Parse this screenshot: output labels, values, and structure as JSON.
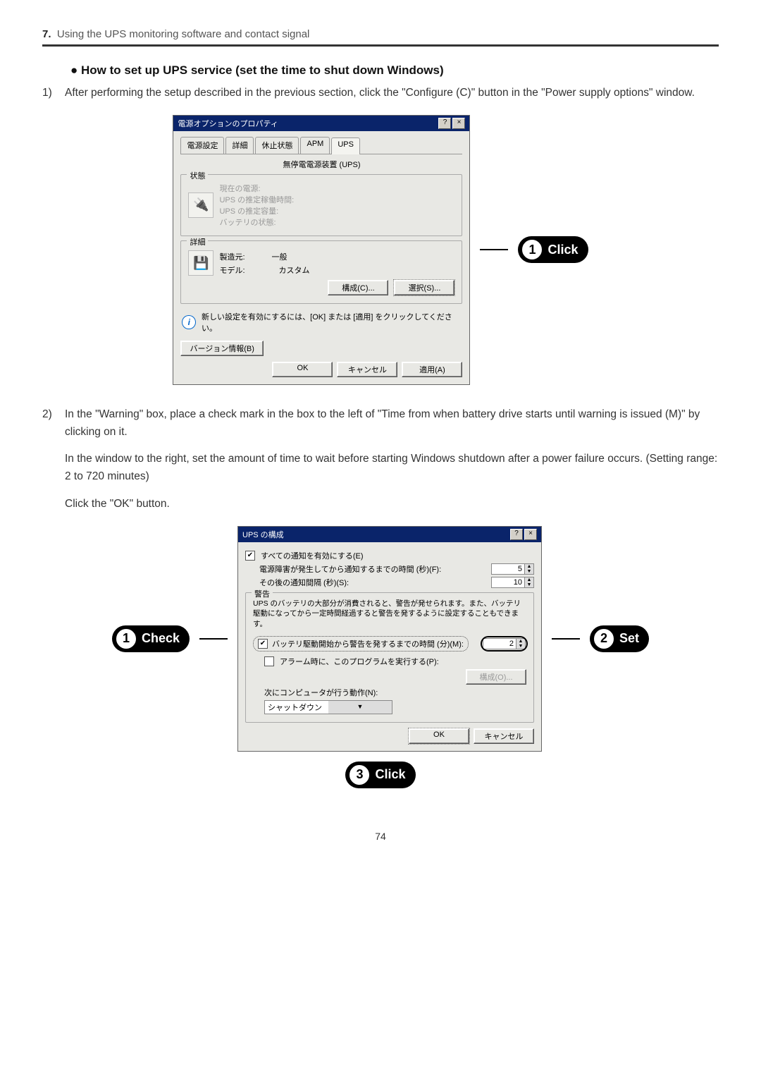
{
  "chapter": {
    "num": "7.",
    "title": "Using the UPS monitoring software and contact signal"
  },
  "section": "● How to set up UPS service (set the time to shut down Windows)",
  "steps": {
    "s1": {
      "num": "1)",
      "text": "After performing the setup described in the previous section, click the \"Configure (C)\" button in the \"Power supply options\" window."
    },
    "s2": {
      "num": "2)",
      "text": "In the \"Warning\" box, place a check mark in the box to the left of \"Time from when battery drive starts until warning is issued (M)\" by clicking on it."
    },
    "s2b": "In the window to the right, set the amount of time to wait before starting Windows shutdown after a power failure occurs. (Setting range: 2 to 720 minutes)",
    "s2c": "Click the \"OK\" button."
  },
  "dialog1": {
    "title": "電源オプションのプロパティ",
    "tabs": [
      "電源設定",
      "詳細",
      "休止状態",
      "APM",
      "UPS"
    ],
    "group1_title": "無停電電源装置 (UPS)",
    "status_legend": "状態",
    "status_lines": [
      "現在の電源:",
      "UPS の推定稼働時間:",
      "UPS の推定容量:",
      "バッテリの状態:"
    ],
    "detail_legend": "詳細",
    "detail_rows": {
      "maker_label": "製造元:",
      "maker_val": "一般",
      "model_label": "モデル:",
      "model_val": "カスタム"
    },
    "configure_btn": "構成(C)...",
    "select_btn": "選択(S)...",
    "info_text": "新しい設定を有効にするには、[OK] または [適用] をクリックしてください。",
    "version_btn": "バージョン情報(B)",
    "ok": "OK",
    "cancel": "キャンセル",
    "apply": "適用(A)"
  },
  "dialog2": {
    "title": "UPS の構成",
    "enable_label": "すべての通知を有効にする(E)",
    "line1": "電源障害が発生してから通知するまでの時間 (秒)(F):",
    "line1_val": "5",
    "line2": "その後の通知間隔 (秒)(S):",
    "line2_val": "10",
    "warn_legend": "警告",
    "warn_desc": "UPS のバッテリの大部分が消費されると、警告が発せられます。また、バッテリ駆動になってから一定時間経過すると警告を発するように設定することもできます。",
    "warn_check_label": "バッテリ駆動開始から警告を発するまでの時間 (分)(M):",
    "warn_val": "2",
    "alarm_check_label": "アラーム時に、このプログラムを実行する(P):",
    "configure_btn": "構成(O)...",
    "next_label": "次にコンピュータが行う動作(N):",
    "next_val": "シャットダウン",
    "ok": "OK",
    "cancel": "キャンセル"
  },
  "callouts": {
    "click": "Click",
    "check": "Check",
    "set": "Set"
  },
  "page_number": "74"
}
